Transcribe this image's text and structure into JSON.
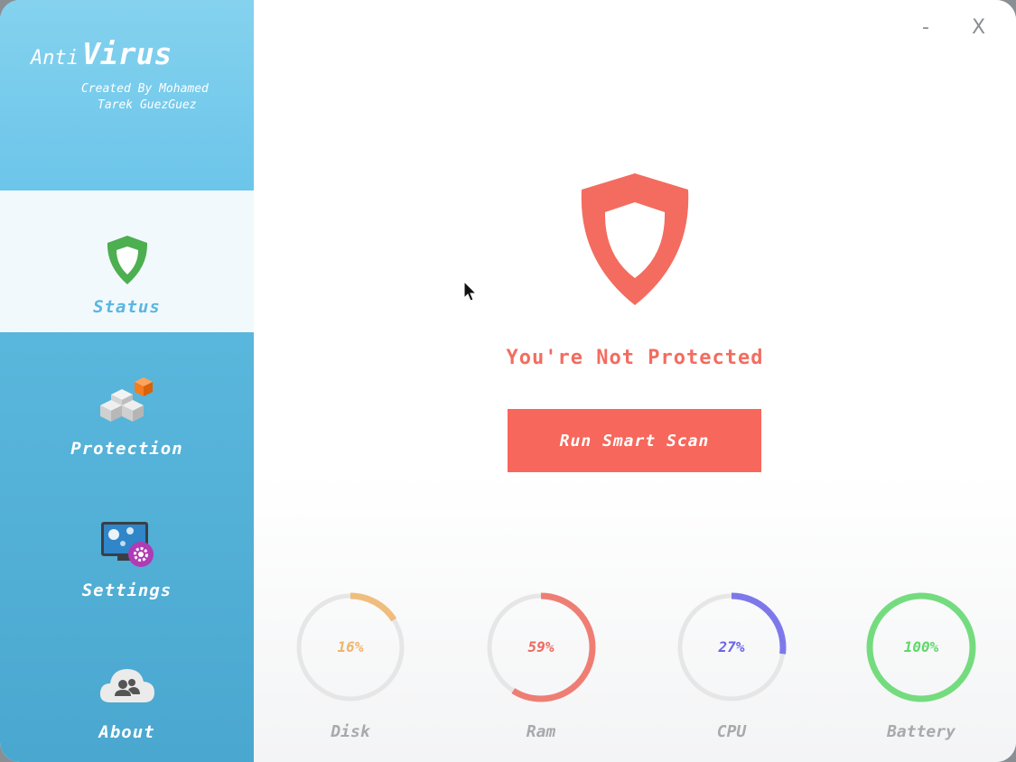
{
  "app": {
    "title_small": "Anti",
    "title_big": "Virus",
    "credit_line1": "Created By Mohamed",
    "credit_line2": "Tarek GuezGuez"
  },
  "window_controls": {
    "minimize": "-",
    "close": "X"
  },
  "sidebar": {
    "items": [
      {
        "label": "Status",
        "icon": "shield-check-icon",
        "active": true
      },
      {
        "label": "Protection",
        "icon": "cubes-icon",
        "active": false
      },
      {
        "label": "Settings",
        "icon": "monitor-gear-icon",
        "active": false
      },
      {
        "label": "About",
        "icon": "cloud-users-icon",
        "active": false
      }
    ]
  },
  "main": {
    "status_text": "You're Not Protected",
    "scan_button": "Run Smart Scan",
    "shield_color": "#f36c5f"
  },
  "gauges": [
    {
      "label": "Disk",
      "value": 16,
      "display": "16%",
      "color": "#f0b56a"
    },
    {
      "label": "Ram",
      "value": 59,
      "display": "59%",
      "color": "#ef6a5e"
    },
    {
      "label": "CPU",
      "value": 27,
      "display": "27%",
      "color": "#6a64ea"
    },
    {
      "label": "Battery",
      "value": 100,
      "display": "100%",
      "color": "#5fd86b"
    }
  ]
}
